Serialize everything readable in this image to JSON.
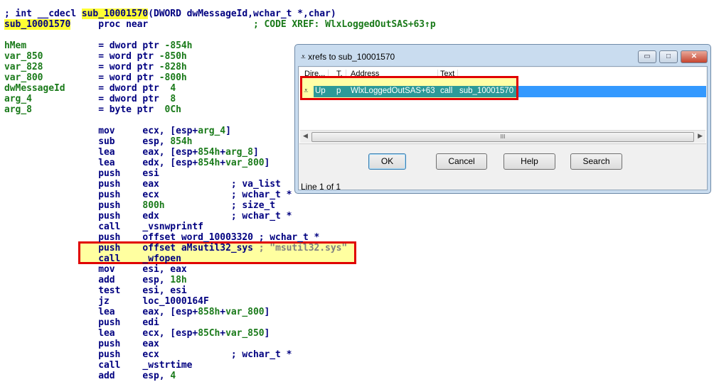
{
  "code_lines": [
    [
      [
        "; int __cdecl ",
        "n"
      ],
      [
        "sub_10001570",
        "n hl"
      ],
      [
        "(DWORD dwMessageId,wchar_t *,char)",
        "n"
      ]
    ],
    [
      [
        "sub_10001570",
        "n hl"
      ],
      [
        "     proc near                   ",
        "n"
      ],
      [
        "; CODE XREF: WlxLoggedOutSAS+63↑p",
        "x"
      ]
    ],
    [],
    [
      [
        "hMem             ",
        "g"
      ],
      [
        "= dword ptr ",
        "n"
      ],
      [
        "-854h",
        "g"
      ]
    ],
    [
      [
        "var_850          ",
        "g"
      ],
      [
        "= word ptr ",
        "n"
      ],
      [
        "-850h",
        "g"
      ]
    ],
    [
      [
        "var_828          ",
        "g"
      ],
      [
        "= word ptr ",
        "n"
      ],
      [
        "-828h",
        "g"
      ]
    ],
    [
      [
        "var_800          ",
        "g"
      ],
      [
        "= word ptr ",
        "n"
      ],
      [
        "-800h",
        "g"
      ]
    ],
    [
      [
        "dwMessageId      ",
        "g"
      ],
      [
        "= dword ptr  ",
        "n"
      ],
      [
        "4",
        "g"
      ]
    ],
    [
      [
        "arg_4            ",
        "g"
      ],
      [
        "= dword ptr  ",
        "n"
      ],
      [
        "8",
        "g"
      ]
    ],
    [
      [
        "arg_8            ",
        "g"
      ],
      [
        "= byte ptr  ",
        "n"
      ],
      [
        "0Ch",
        "g"
      ]
    ],
    [],
    [
      [
        "                 mov     ecx, [esp+",
        "n"
      ],
      [
        "arg_4",
        "g"
      ],
      [
        "]",
        "n"
      ]
    ],
    [
      [
        "                 sub     esp, ",
        "n"
      ],
      [
        "854h",
        "g"
      ]
    ],
    [
      [
        "                 lea     eax, [esp+",
        "n"
      ],
      [
        "854h",
        "g"
      ],
      [
        "+",
        "n"
      ],
      [
        "arg_8",
        "g"
      ],
      [
        "]",
        "n"
      ]
    ],
    [
      [
        "                 lea     edx, [esp+",
        "n"
      ],
      [
        "854h",
        "g"
      ],
      [
        "+",
        "n"
      ],
      [
        "var_800",
        "g"
      ],
      [
        "]",
        "n"
      ]
    ],
    [
      [
        "                 push    esi",
        "n"
      ]
    ],
    [
      [
        "                 push    eax             ; va_list",
        "n"
      ]
    ],
    [
      [
        "                 push    ecx             ; wchar_t *",
        "n"
      ]
    ],
    [
      [
        "                 push    ",
        "n"
      ],
      [
        "800h",
        "g"
      ],
      [
        "            ; size_t",
        "n"
      ]
    ],
    [
      [
        "                 push    edx             ; wchar_t *",
        "n"
      ]
    ],
    [
      [
        "                 call    _vsnwprintf",
        "n"
      ]
    ],
    [
      [
        "                 push    offset word_10003320 ; wchar_t *",
        "n"
      ]
    ],
    [
      [
        "                 push    offset aMsutil32_sys ",
        "n"
      ],
      [
        "; \"msutil32.sys\"",
        "s"
      ]
    ],
    [
      [
        "                 call    _wfopen",
        "n"
      ]
    ],
    [
      [
        "                 mov     esi, eax",
        "n"
      ]
    ],
    [
      [
        "                 add     esp, ",
        "n"
      ],
      [
        "18h",
        "g"
      ]
    ],
    [
      [
        "                 test    esi, esi",
        "n"
      ]
    ],
    [
      [
        "                 jz      loc_1000164F",
        "n"
      ]
    ],
    [
      [
        "                 lea     eax, [esp+",
        "n"
      ],
      [
        "858h",
        "g"
      ],
      [
        "+",
        "n"
      ],
      [
        "var_800",
        "g"
      ],
      [
        "]",
        "n"
      ]
    ],
    [
      [
        "                 push    edi",
        "n"
      ]
    ],
    [
      [
        "                 lea     ecx, [esp+",
        "n"
      ],
      [
        "85Ch",
        "g"
      ],
      [
        "+",
        "n"
      ],
      [
        "var_850",
        "g"
      ],
      [
        "]",
        "n"
      ]
    ],
    [
      [
        "                 push    eax",
        "n"
      ]
    ],
    [
      [
        "                 push    ecx             ; wchar_t *",
        "n"
      ]
    ],
    [
      [
        "                 call    _wstrtime",
        "n"
      ]
    ],
    [
      [
        "                 add     esp, ",
        "n"
      ],
      [
        "4",
        "g"
      ]
    ]
  ],
  "dialog": {
    "title": "xrefs to sub_10001570",
    "columns": [
      "Dire...",
      "T.",
      "Address",
      "Text"
    ],
    "row": {
      "direction": "Up",
      "type": "p",
      "address": "WlxLoggedOutSAS+63",
      "text_op": "call",
      "text_target": "sub_10001570"
    },
    "buttons": {
      "ok": "OK",
      "cancel": "Cancel",
      "help": "Help",
      "search": "Search"
    },
    "scroll_thumb": "III",
    "status": "Line 1 of 1"
  },
  "colors": {
    "highlight": "#ffff33",
    "annotation_box": "#e00000",
    "selection": "#3399ff"
  }
}
